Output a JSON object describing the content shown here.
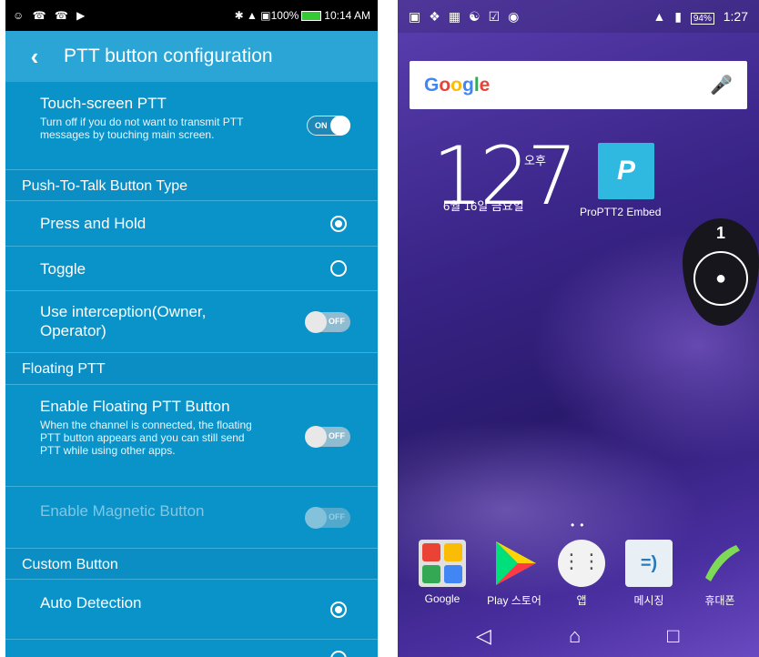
{
  "left": {
    "status": {
      "left_icons": "☺ ☎ ☎ ▶",
      "right_text": "✱ ▲ ▣100%",
      "time": "10:14 AM"
    },
    "title": "PTT button configuration",
    "touch_ptt": {
      "title": "Touch-screen PTT",
      "desc": "Turn off if you do not want to transmit PTT messages by touching main screen.",
      "toggle": "ON"
    },
    "section_type": "Push-To-Talk Button Type",
    "press_hold": "Press and Hold",
    "toggle_opt": "Toggle",
    "interception": {
      "title": "Use interception(Owner, Operator)",
      "toggle": "OFF"
    },
    "section_floating": "Floating PTT",
    "floating": {
      "title": "Enable Floating PTT Button",
      "desc": "When the channel is connected, the floating PTT button appears and you can still send PTT while using other apps.",
      "toggle": "OFF"
    },
    "magnetic": {
      "title": "Enable Magnetic Button",
      "toggle": "OFF"
    },
    "section_custom": "Custom Button",
    "auto_detection": "Auto Detection"
  },
  "right": {
    "status": {
      "battery": "94%",
      "time": "1:27"
    },
    "search_logo": "Google",
    "clock": {
      "digits": "127",
      "ampm": "오후",
      "date": "6월 16일 금요일"
    },
    "app": {
      "label": "ProPTT2 Embed"
    },
    "floating_num": "1",
    "dock": [
      "Google",
      "Play 스토어",
      "앱",
      "메시징",
      "휴대폰"
    ]
  }
}
